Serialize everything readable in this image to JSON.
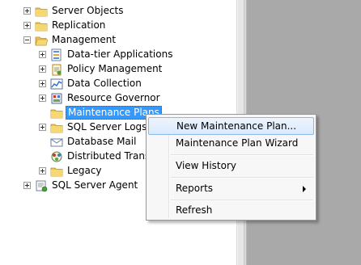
{
  "tree": {
    "items": [
      {
        "label": "Server Objects",
        "icon": "folder-icon"
      },
      {
        "label": "Replication",
        "icon": "folder-icon"
      },
      {
        "label": "Management",
        "icon": "folder-open-icon"
      },
      {
        "label": "Data-tier Applications",
        "icon": "data-tier-icon"
      },
      {
        "label": "Policy Management",
        "icon": "policy-icon"
      },
      {
        "label": "Data Collection",
        "icon": "data-collection-icon"
      },
      {
        "label": "Resource Governor",
        "icon": "resource-governor-icon"
      },
      {
        "label": "Maintenance Plans",
        "icon": "folder-icon"
      },
      {
        "label": "SQL Server Logs",
        "icon": "folder-icon"
      },
      {
        "label": "Database Mail",
        "icon": "mail-icon"
      },
      {
        "label": "Distributed Transac",
        "icon": "distributed-transaction-icon"
      },
      {
        "label": "Legacy",
        "icon": "folder-icon"
      },
      {
        "label": "SQL Server Agent",
        "icon": "agent-icon"
      }
    ]
  },
  "context_menu": {
    "items": [
      {
        "label": "New Maintenance Plan..."
      },
      {
        "label": "Maintenance Plan Wizard"
      },
      {
        "label": "View History"
      },
      {
        "label": "Reports"
      },
      {
        "label": "Refresh"
      }
    ]
  },
  "colors": {
    "selection": "#3399ff",
    "folder": "#e8c35a",
    "right_pane": "#a9a9a9"
  }
}
